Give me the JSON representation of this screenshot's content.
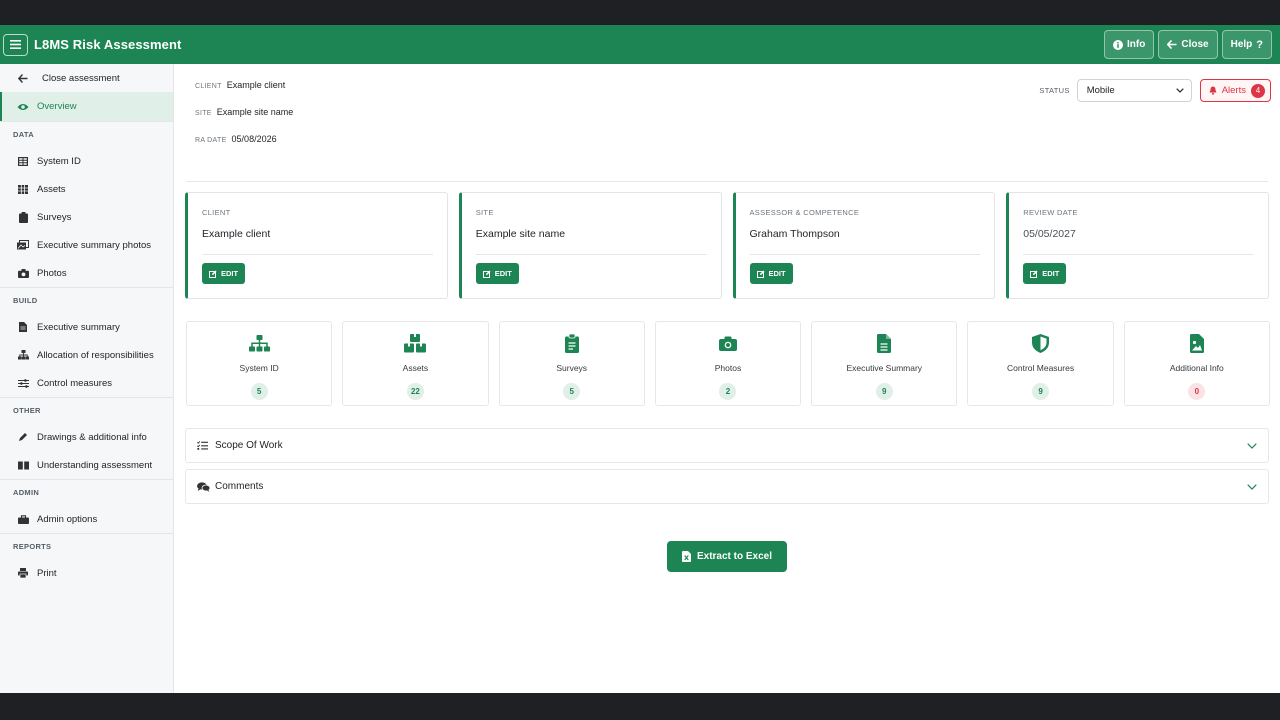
{
  "app": {
    "title": "L8MS Risk Assessment",
    "accent": "#1c8553",
    "actions": [
      {
        "label": "Info",
        "icon": "info-circle-icon"
      },
      {
        "label": "Close",
        "icon": "arrow-left-icon"
      },
      {
        "label": "Help",
        "icon": "question-icon"
      }
    ]
  },
  "sidebar": {
    "close_label": "Close assessment",
    "overview_label": "Overview",
    "sections": {
      "data": "DATA",
      "build": "BUILD",
      "other": "OTHER",
      "admin": "ADMIN",
      "reports": "REPORTS"
    },
    "items": {
      "system_id": "System ID",
      "assets": "Assets",
      "surveys": "Surveys",
      "exec_photos": "Executive summary photos",
      "photos": "Photos",
      "exec_summary": "Executive summary",
      "allocation": "Allocation of responsibilities",
      "control_measures": "Control measures",
      "drawings": "Drawings & additional info",
      "understanding": "Understanding assessment",
      "admin_options": "Admin options",
      "print": "Print"
    }
  },
  "header": {
    "client_key": "CLIENT",
    "client_value": "Example client",
    "site_key": "SITE",
    "site_value": "Example site name",
    "radate_key": "RA DATE",
    "radate_value": "05/08/2026",
    "status_key": "STATUS",
    "status_value": "Mobile",
    "alerts_label": "Alerts",
    "alerts_count": "4"
  },
  "cards": [
    {
      "key": "CLIENT",
      "value": "Example client",
      "edit": "EDIT"
    },
    {
      "key": "SITE",
      "value": "Example site name",
      "edit": "EDIT"
    },
    {
      "key": "ASSESSOR & COMPETENCE",
      "value": "Graham Thompson",
      "edit": "EDIT"
    },
    {
      "key": "REVIEW DATE",
      "value": "05/05/2027",
      "edit": "EDIT"
    }
  ],
  "stats": [
    {
      "label": "System ID",
      "count": "5",
      "icon": "sitemap-icon"
    },
    {
      "label": "Assets",
      "count": "22",
      "icon": "boxes-icon"
    },
    {
      "label": "Surveys",
      "count": "5",
      "icon": "clipboard-icon"
    },
    {
      "label": "Photos",
      "count": "2",
      "icon": "camera-icon"
    },
    {
      "label": "Executive Summary",
      "count": "9",
      "icon": "file-icon"
    },
    {
      "label": "Control Measures",
      "count": "9",
      "icon": "shield-icon"
    },
    {
      "label": "Additional Info",
      "count": "0",
      "icon": "file-image-icon"
    }
  ],
  "accordions": {
    "scope": "Scope Of Work",
    "comments": "Comments"
  },
  "extract_label": "Extract to Excel"
}
